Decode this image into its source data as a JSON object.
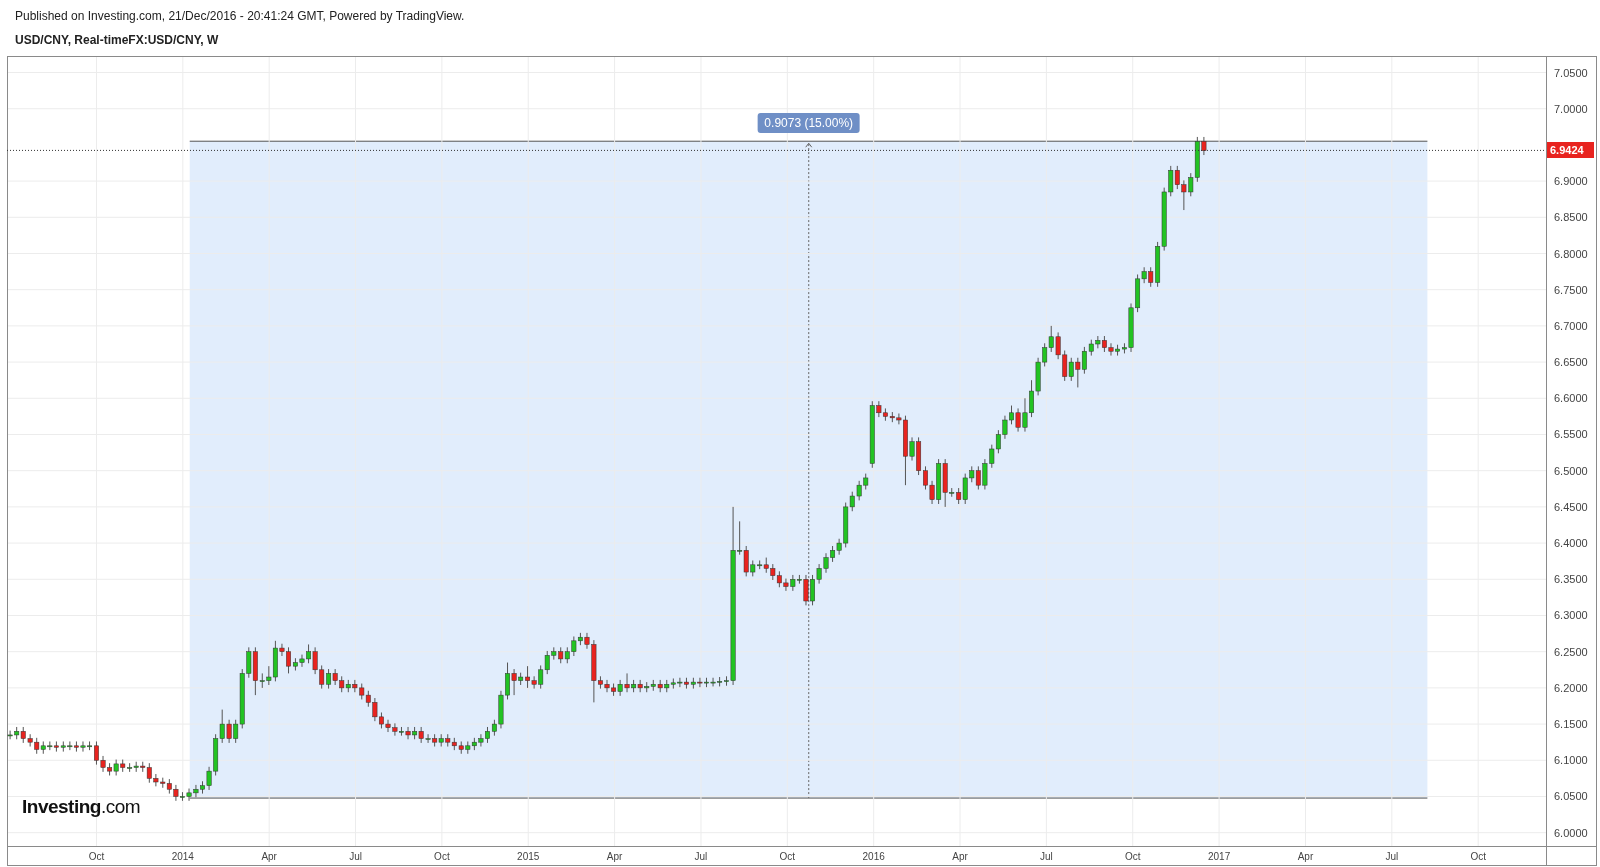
{
  "header": {
    "published": "Published on Investing.com, 21/Dec/2016 - 20:41:24 GMT, Powered by TradingView.",
    "symbol": "USD/CNY, Real-timeFX:USD/CNY, W"
  },
  "chart": {
    "logo": "**Investing**.com",
    "chart_data": {
      "type": "candlestick",
      "grid": true,
      "xlim": [
        2013.491,
        2018.094
      ],
      "ylim": [
        5.9816,
        7.0728
      ],
      "x": [
        2013.5,
        2013.519,
        2013.538,
        2013.558,
        2013.577,
        2013.596,
        2013.615,
        2013.634,
        2013.654,
        2013.673,
        2013.692,
        2013.711,
        2013.73,
        2013.75,
        2013.769,
        2013.788,
        2013.807,
        2013.826,
        2013.846,
        2013.865,
        2013.884,
        2013.903,
        2013.922,
        2013.942,
        2013.961,
        2013.98,
        2013.999,
        2014.018,
        2014.038,
        2014.057,
        2014.076,
        2014.095,
        2014.114,
        2014.134,
        2014.153,
        2014.172,
        2014.191,
        2014.21,
        2014.23,
        2014.249,
        2014.268,
        2014.287,
        2014.306,
        2014.326,
        2014.345,
        2014.364,
        2014.383,
        2014.402,
        2014.422,
        2014.441,
        2014.46,
        2014.479,
        2014.498,
        2014.518,
        2014.537,
        2014.556,
        2014.575,
        2014.594,
        2014.614,
        2014.633,
        2014.652,
        2014.671,
        2014.69,
        2014.71,
        2014.729,
        2014.748,
        2014.767,
        2014.786,
        2014.806,
        2014.825,
        2014.844,
        2014.863,
        2014.882,
        2014.902,
        2014.921,
        2014.94,
        2014.959,
        2014.978,
        2014.998,
        2015.017,
        2015.036,
        2015.055,
        2015.074,
        2015.094,
        2015.113,
        2015.132,
        2015.151,
        2015.17,
        2015.19,
        2015.209,
        2015.228,
        2015.247,
        2015.266,
        2015.286,
        2015.305,
        2015.324,
        2015.343,
        2015.362,
        2015.382,
        2015.401,
        2015.42,
        2015.439,
        2015.458,
        2015.478,
        2015.497,
        2015.516,
        2015.535,
        2015.554,
        2015.574,
        2015.593,
        2015.612,
        2015.631,
        2015.65,
        2015.67,
        2015.689,
        2015.708,
        2015.727,
        2015.746,
        2015.766,
        2015.785,
        2015.804,
        2015.823,
        2015.842,
        2015.862,
        2015.881,
        2015.9,
        2015.919,
        2015.938,
        2015.958,
        2015.977,
        2015.996,
        2016.015,
        2016.034,
        2016.054,
        2016.073,
        2016.092,
        2016.111,
        2016.13,
        2016.15,
        2016.169,
        2016.188,
        2016.207,
        2016.226,
        2016.246,
        2016.265,
        2016.284,
        2016.303,
        2016.322,
        2016.342,
        2016.361,
        2016.38,
        2016.399,
        2016.418,
        2016.438,
        2016.457,
        2016.476,
        2016.495,
        2016.514,
        2016.534,
        2016.553,
        2016.572,
        2016.591,
        2016.61,
        2016.63,
        2016.649,
        2016.668,
        2016.687,
        2016.706,
        2016.726,
        2016.745,
        2016.764,
        2016.783,
        2016.802,
        2016.822,
        2016.841,
        2016.86,
        2016.879,
        2016.898,
        2016.918,
        2016.937,
        2016.956
      ],
      "ohlc": [
        [
          6.135,
          6.141,
          6.129,
          6.135
        ],
        [
          6.135,
          6.146,
          6.129,
          6.14
        ],
        [
          6.14,
          6.146,
          6.124,
          6.13
        ],
        [
          6.13,
          6.136,
          6.119,
          6.125
        ],
        [
          6.125,
          6.131,
          6.109,
          6.115
        ],
        [
          6.115,
          6.126,
          6.109,
          6.12
        ],
        [
          6.12,
          6.126,
          6.114,
          6.12
        ],
        [
          6.12,
          6.126,
          6.112,
          6.118
        ],
        [
          6.118,
          6.126,
          6.112,
          6.12
        ],
        [
          6.12,
          6.126,
          6.114,
          6.12
        ],
        [
          6.12,
          6.126,
          6.112,
          6.118
        ],
        [
          6.118,
          6.126,
          6.112,
          6.12
        ],
        [
          6.12,
          6.126,
          6.114,
          6.12
        ],
        [
          6.12,
          6.126,
          6.094,
          6.1
        ],
        [
          6.1,
          6.106,
          6.084,
          6.09
        ],
        [
          6.09,
          6.096,
          6.079,
          6.085
        ],
        [
          6.085,
          6.101,
          6.079,
          6.095
        ],
        [
          6.095,
          6.101,
          6.084,
          6.09
        ],
        [
          6.09,
          6.096,
          6.084,
          6.09
        ],
        [
          6.09,
          6.098,
          6.084,
          6.092
        ],
        [
          6.092,
          6.098,
          6.084,
          6.09
        ],
        [
          6.09,
          6.096,
          6.069,
          6.075
        ],
        [
          6.075,
          6.081,
          6.064,
          6.07
        ],
        [
          6.07,
          6.076,
          6.062,
          6.068
        ],
        [
          6.068,
          6.074,
          6.054,
          6.06
        ],
        [
          6.06,
          6.066,
          6.044,
          6.05
        ],
        [
          6.05,
          6.056,
          6.044,
          6.05
        ],
        [
          6.05,
          6.061,
          6.044,
          6.055
        ],
        [
          6.055,
          6.066,
          6.049,
          6.06
        ],
        [
          6.06,
          6.071,
          6.054,
          6.065
        ],
        [
          6.065,
          6.091,
          6.059,
          6.085
        ],
        [
          6.085,
          6.136,
          6.079,
          6.13
        ],
        [
          6.13,
          6.17,
          6.124,
          6.15
        ],
        [
          6.15,
          6.156,
          6.124,
          6.13
        ],
        [
          6.13,
          6.156,
          6.124,
          6.15
        ],
        [
          6.15,
          6.226,
          6.144,
          6.22
        ],
        [
          6.22,
          6.256,
          6.214,
          6.25
        ],
        [
          6.25,
          6.256,
          6.19,
          6.21
        ],
        [
          6.21,
          6.22,
          6.2,
          6.21
        ],
        [
          6.21,
          6.23,
          6.204,
          6.215
        ],
        [
          6.215,
          6.265,
          6.209,
          6.255
        ],
        [
          6.255,
          6.261,
          6.244,
          6.25
        ],
        [
          6.25,
          6.256,
          6.22,
          6.23
        ],
        [
          6.23,
          6.241,
          6.224,
          6.235
        ],
        [
          6.235,
          6.246,
          6.229,
          6.24
        ],
        [
          6.24,
          6.26,
          6.234,
          6.25
        ],
        [
          6.25,
          6.256,
          6.219,
          6.225
        ],
        [
          6.225,
          6.231,
          6.199,
          6.205
        ],
        [
          6.205,
          6.226,
          6.199,
          6.22
        ],
        [
          6.22,
          6.226,
          6.204,
          6.21
        ],
        [
          6.21,
          6.216,
          6.194,
          6.2
        ],
        [
          6.2,
          6.211,
          6.194,
          6.205
        ],
        [
          6.205,
          6.211,
          6.194,
          6.2
        ],
        [
          6.2,
          6.206,
          6.184,
          6.19
        ],
        [
          6.19,
          6.196,
          6.174,
          6.18
        ],
        [
          6.18,
          6.186,
          6.154,
          6.16
        ],
        [
          6.16,
          6.166,
          6.144,
          6.15
        ],
        [
          6.15,
          6.156,
          6.139,
          6.145
        ],
        [
          6.145,
          6.151,
          6.134,
          6.14
        ],
        [
          6.14,
          6.146,
          6.134,
          6.14
        ],
        [
          6.14,
          6.146,
          6.129,
          6.135
        ],
        [
          6.135,
          6.146,
          6.129,
          6.14
        ],
        [
          6.14,
          6.146,
          6.124,
          6.13
        ],
        [
          6.13,
          6.136,
          6.124,
          6.13
        ],
        [
          6.13,
          6.136,
          6.119,
          6.125
        ],
        [
          6.125,
          6.136,
          6.119,
          6.13
        ],
        [
          6.13,
          6.136,
          6.119,
          6.125
        ],
        [
          6.125,
          6.131,
          6.114,
          6.12
        ],
        [
          6.12,
          6.126,
          6.109,
          6.115
        ],
        [
          6.115,
          6.126,
          6.109,
          6.12
        ],
        [
          6.12,
          6.131,
          6.114,
          6.125
        ],
        [
          6.125,
          6.136,
          6.119,
          6.13
        ],
        [
          6.13,
          6.146,
          6.124,
          6.14
        ],
        [
          6.14,
          6.156,
          6.134,
          6.15
        ],
        [
          6.15,
          6.196,
          6.144,
          6.19
        ],
        [
          6.19,
          6.235,
          6.184,
          6.22
        ],
        [
          6.22,
          6.226,
          6.19,
          6.21
        ],
        [
          6.21,
          6.221,
          6.204,
          6.215
        ],
        [
          6.215,
          6.23,
          6.2,
          6.21
        ],
        [
          6.21,
          6.216,
          6.199,
          6.205
        ],
        [
          6.205,
          6.231,
          6.199,
          6.225
        ],
        [
          6.225,
          6.251,
          6.219,
          6.245
        ],
        [
          6.245,
          6.256,
          6.239,
          6.25
        ],
        [
          6.25,
          6.256,
          6.234,
          6.24
        ],
        [
          6.24,
          6.256,
          6.234,
          6.25
        ],
        [
          6.25,
          6.271,
          6.244,
          6.265
        ],
        [
          6.265,
          6.276,
          6.259,
          6.27
        ],
        [
          6.27,
          6.276,
          6.254,
          6.26
        ],
        [
          6.26,
          6.266,
          6.18,
          6.21
        ],
        [
          6.21,
          6.216,
          6.199,
          6.205
        ],
        [
          6.205,
          6.211,
          6.194,
          6.2
        ],
        [
          6.2,
          6.206,
          6.189,
          6.195
        ],
        [
          6.195,
          6.211,
          6.189,
          6.205
        ],
        [
          6.205,
          6.22,
          6.194,
          6.2
        ],
        [
          6.2,
          6.211,
          6.194,
          6.205
        ],
        [
          6.205,
          6.211,
          6.194,
          6.2
        ],
        [
          6.2,
          6.208,
          6.194,
          6.202
        ],
        [
          6.202,
          6.211,
          6.196,
          6.205
        ],
        [
          6.205,
          6.211,
          6.194,
          6.2
        ],
        [
          6.2,
          6.211,
          6.194,
          6.205
        ],
        [
          6.205,
          6.213,
          6.199,
          6.207
        ],
        [
          6.207,
          6.214,
          6.201,
          6.208
        ],
        [
          6.208,
          6.214,
          6.199,
          6.205
        ],
        [
          6.205,
          6.214,
          6.199,
          6.208
        ],
        [
          6.208,
          6.214,
          6.201,
          6.207
        ],
        [
          6.207,
          6.214,
          6.201,
          6.208
        ],
        [
          6.208,
          6.214,
          6.202,
          6.208
        ],
        [
          6.208,
          6.215,
          6.202,
          6.209
        ],
        [
          6.209,
          6.216,
          6.203,
          6.21
        ],
        [
          6.21,
          6.45,
          6.204,
          6.39
        ],
        [
          6.39,
          6.43,
          6.384,
          6.39
        ],
        [
          6.39,
          6.396,
          6.354,
          6.36
        ],
        [
          6.36,
          6.376,
          6.354,
          6.37
        ],
        [
          6.37,
          6.376,
          6.364,
          6.37
        ],
        [
          6.37,
          6.38,
          6.359,
          6.365
        ],
        [
          6.365,
          6.371,
          6.349,
          6.355
        ],
        [
          6.355,
          6.361,
          6.339,
          6.345
        ],
        [
          6.345,
          6.351,
          6.334,
          6.34
        ],
        [
          6.34,
          6.356,
          6.334,
          6.35
        ],
        [
          6.35,
          6.356,
          6.344,
          6.35
        ],
        [
          6.35,
          6.356,
          6.314,
          6.32
        ],
        [
          6.32,
          6.356,
          6.314,
          6.35
        ],
        [
          6.35,
          6.371,
          6.344,
          6.365
        ],
        [
          6.365,
          6.386,
          6.359,
          6.38
        ],
        [
          6.38,
          6.396,
          6.374,
          6.39
        ],
        [
          6.39,
          6.406,
          6.384,
          6.4
        ],
        [
          6.4,
          6.456,
          6.394,
          6.45
        ],
        [
          6.45,
          6.471,
          6.444,
          6.465
        ],
        [
          6.465,
          6.486,
          6.459,
          6.48
        ],
        [
          6.48,
          6.496,
          6.474,
          6.49
        ],
        [
          6.51,
          6.596,
          6.504,
          6.59
        ],
        [
          6.59,
          6.596,
          6.574,
          6.58
        ],
        [
          6.58,
          6.586,
          6.569,
          6.575
        ],
        [
          6.575,
          6.581,
          6.567,
          6.573
        ],
        [
          6.573,
          6.579,
          6.564,
          6.57
        ],
        [
          6.57,
          6.576,
          6.48,
          6.52
        ],
        [
          6.52,
          6.546,
          6.514,
          6.54
        ],
        [
          6.54,
          6.546,
          6.494,
          6.5
        ],
        [
          6.5,
          6.506,
          6.474,
          6.48
        ],
        [
          6.48,
          6.486,
          6.454,
          6.46
        ],
        [
          6.46,
          6.516,
          6.454,
          6.51
        ],
        [
          6.51,
          6.516,
          6.45,
          6.47
        ],
        [
          6.47,
          6.476,
          6.464,
          6.47
        ],
        [
          6.47,
          6.476,
          6.454,
          6.46
        ],
        [
          6.46,
          6.496,
          6.454,
          6.49
        ],
        [
          6.49,
          6.506,
          6.484,
          6.5
        ],
        [
          6.5,
          6.506,
          6.474,
          6.48
        ],
        [
          6.48,
          6.516,
          6.474,
          6.51
        ],
        [
          6.51,
          6.536,
          6.504,
          6.53
        ],
        [
          6.53,
          6.556,
          6.524,
          6.55
        ],
        [
          6.55,
          6.576,
          6.544,
          6.57
        ],
        [
          6.57,
          6.59,
          6.564,
          6.58
        ],
        [
          6.58,
          6.586,
          6.554,
          6.56
        ],
        [
          6.56,
          6.6,
          6.554,
          6.58
        ],
        [
          6.58,
          6.625,
          6.574,
          6.61
        ],
        [
          6.61,
          6.656,
          6.604,
          6.65
        ],
        [
          6.65,
          6.676,
          6.644,
          6.67
        ],
        [
          6.67,
          6.7,
          6.664,
          6.685
        ],
        [
          6.685,
          6.691,
          6.654,
          6.66
        ],
        [
          6.66,
          6.666,
          6.624,
          6.63
        ],
        [
          6.63,
          6.656,
          6.624,
          6.65
        ],
        [
          6.65,
          6.656,
          6.615,
          6.64
        ],
        [
          6.64,
          6.671,
          6.634,
          6.665
        ],
        [
          6.665,
          6.681,
          6.659,
          6.675
        ],
        [
          6.675,
          6.686,
          6.669,
          6.68
        ],
        [
          6.68,
          6.686,
          6.664,
          6.67
        ],
        [
          6.67,
          6.676,
          6.659,
          6.665
        ],
        [
          6.665,
          6.674,
          6.659,
          6.668
        ],
        [
          6.668,
          6.676,
          6.662,
          6.67
        ],
        [
          6.67,
          6.731,
          6.664,
          6.725
        ],
        [
          6.725,
          6.771,
          6.719,
          6.765
        ],
        [
          6.765,
          6.781,
          6.759,
          6.775
        ],
        [
          6.775,
          6.781,
          6.754,
          6.76
        ],
        [
          6.76,
          6.816,
          6.754,
          6.81
        ],
        [
          6.81,
          6.891,
          6.804,
          6.885
        ],
        [
          6.885,
          6.921,
          6.879,
          6.915
        ],
        [
          6.915,
          6.921,
          6.889,
          6.895
        ],
        [
          6.895,
          6.901,
          6.86,
          6.885
        ],
        [
          6.885,
          6.911,
          6.879,
          6.905
        ],
        [
          6.905,
          6.961,
          6.899,
          6.955
        ],
        [
          6.955,
          6.961,
          6.936,
          6.942
        ]
      ],
      "xticks": [
        {
          "value": 2013.75,
          "label": "Oct"
        },
        {
          "value": 2014,
          "label": "2014"
        },
        {
          "value": 2014.25,
          "label": "Apr"
        },
        {
          "value": 2014.5,
          "label": "Jul"
        },
        {
          "value": 2014.75,
          "label": "Oct"
        },
        {
          "value": 2015,
          "label": "2015"
        },
        {
          "value": 2015.25,
          "label": "Apr"
        },
        {
          "value": 2015.5,
          "label": "Jul"
        },
        {
          "value": 2015.75,
          "label": "Oct"
        },
        {
          "value": 2016,
          "label": "2016"
        },
        {
          "value": 2016.25,
          "label": "Apr"
        },
        {
          "value": 2016.5,
          "label": "Jul"
        },
        {
          "value": 2016.75,
          "label": "Oct"
        },
        {
          "value": 2017,
          "label": "2017"
        },
        {
          "value": 2017.25,
          "label": "Apr"
        },
        {
          "value": 2017.5,
          "label": "Jul"
        },
        {
          "value": 2017.75,
          "label": "Oct"
        }
      ],
      "yticks": [
        {
          "value": 6.0,
          "label": "6.0000"
        },
        {
          "value": 6.05,
          "label": "6.0500"
        },
        {
          "value": 6.1,
          "label": "6.1000"
        },
        {
          "value": 6.15,
          "label": "6.1500"
        },
        {
          "value": 6.2,
          "label": "6.2000"
        },
        {
          "value": 6.25,
          "label": "6.2500"
        },
        {
          "value": 6.3,
          "label": "6.3000"
        },
        {
          "value": 6.35,
          "label": "6.3500"
        },
        {
          "value": 6.4,
          "label": "6.4000"
        },
        {
          "value": 6.45,
          "label": "6.4500"
        },
        {
          "value": 6.5,
          "label": "6.5000"
        },
        {
          "value": 6.55,
          "label": "6.5500"
        },
        {
          "value": 6.6,
          "label": "6.6000"
        },
        {
          "value": 6.65,
          "label": "6.6500"
        },
        {
          "value": 6.7,
          "label": "6.7000"
        },
        {
          "value": 6.75,
          "label": "6.7500"
        },
        {
          "value": 6.8,
          "label": "6.8000"
        },
        {
          "value": 6.85,
          "label": "6.8500"
        },
        {
          "value": 6.9,
          "label": "6.9000"
        },
        {
          "value": 7.0,
          "label": "7.0000"
        },
        {
          "value": 7.05,
          "label": "7.0500"
        }
      ],
      "ref_lines": [
        {
          "axis": "y",
          "value": 6.9424,
          "label": "6.9424"
        }
      ],
      "annotations": [
        "0.9073 (15.00%)"
      ]
    }
  }
}
